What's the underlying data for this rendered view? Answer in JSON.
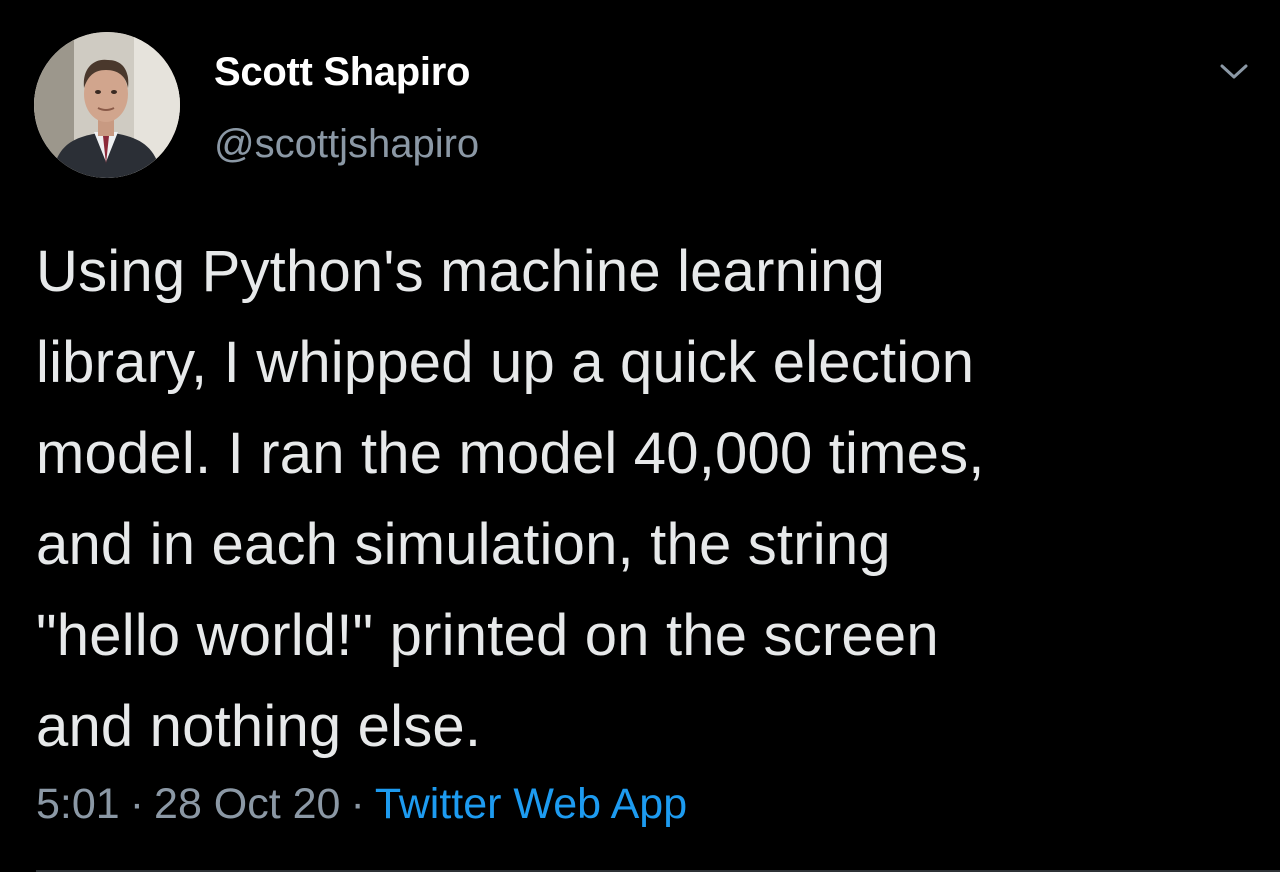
{
  "author": {
    "name": "Scott Shapiro",
    "handle": "@scottjshapiro"
  },
  "tweet": {
    "text": "Using Python's machine learning\nlibrary, I whipped up a quick election\nmodel. I ran the model 40,000 times,\nand in each simulation, the string\n\"hello world!\" printed on the screen\nand nothing else.",
    "time": "5:01",
    "separator": "·",
    "date": "28 Oct 20",
    "source": "Twitter Web App"
  },
  "icons": {
    "menu": "chevron-down-icon",
    "avatar": "profile-photo"
  },
  "colors": {
    "background": "#000000",
    "name": "#ffffff",
    "body_text": "#e7e9ea",
    "secondary_text": "#8b98a5",
    "link": "#1d9bf0"
  }
}
